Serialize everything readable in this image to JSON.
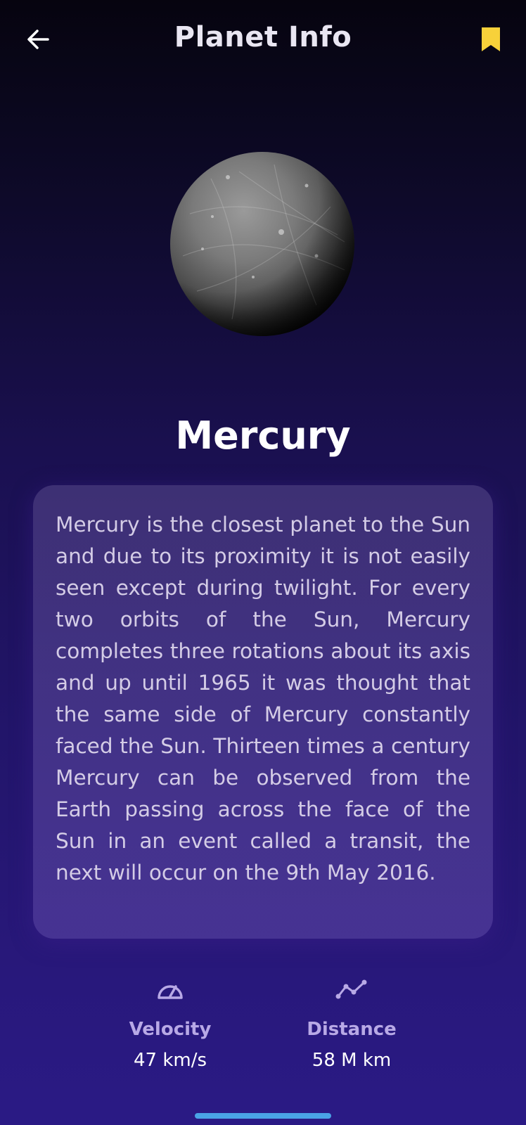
{
  "header": {
    "title": "Planet Info",
    "back_icon": "arrow-left-icon",
    "bookmark_icon": "bookmark-icon",
    "bookmark_color": "#f7d13a"
  },
  "planet": {
    "name": "Mercury",
    "image": "mercury-planet-image",
    "description": "Mercury is the closest planet to the Sun and due to its proximity it is not easily seen except during twilight. For every two orbits of the Sun, Mercury completes three rotations about its axis and up until 1965 it was thought that the same side of Mercury constantly faced the Sun. Thirteen times a century Mercury can be observed from the Earth passing across the face of the Sun in an event called a transit, the next will occur on the 9th May 2016."
  },
  "stats": {
    "velocity": {
      "icon": "speedometer-icon",
      "label": "Velocity",
      "value": "47 km/s"
    },
    "distance": {
      "icon": "distance-graph-icon",
      "label": "Distance",
      "value": "58 M km"
    }
  },
  "colors": {
    "accent": "#b8a9e6",
    "home_indicator": "#4aa3e6"
  }
}
